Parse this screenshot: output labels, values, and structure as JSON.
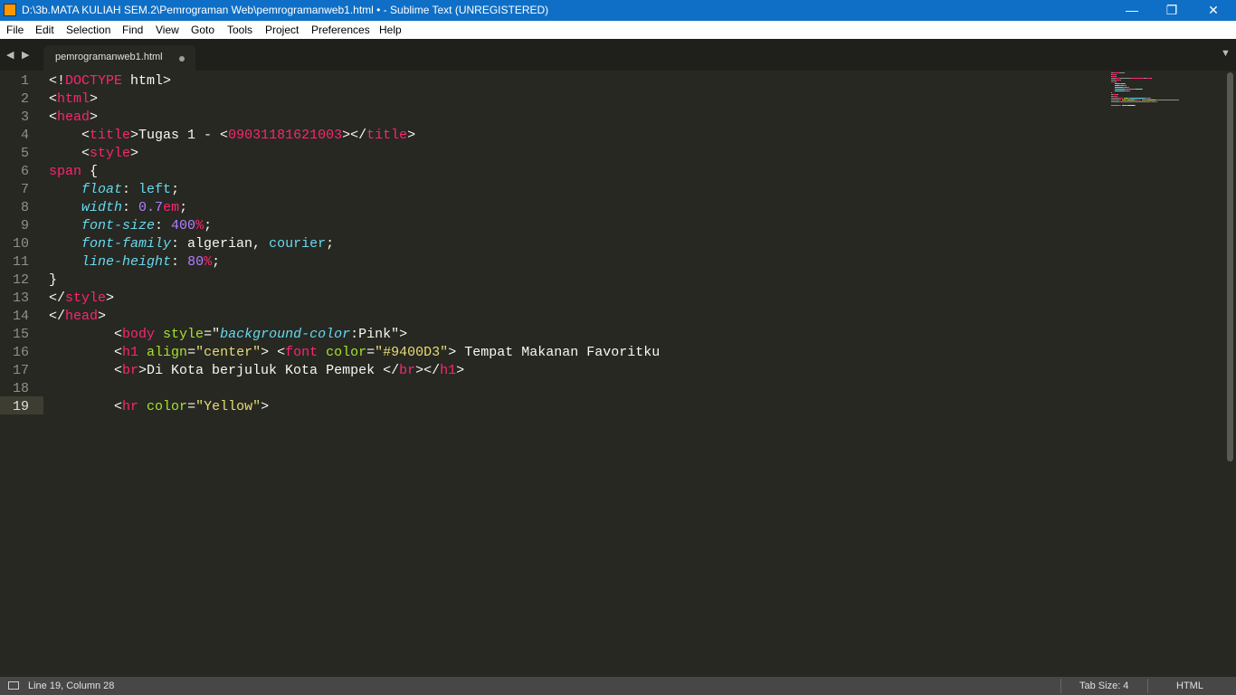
{
  "window": {
    "title": "D:\\3b.MATA KULIAH SEM.2\\Pemrograman Web\\pemrogramanweb1.html • - Sublime Text (UNREGISTERED)",
    "minimize": "—",
    "maximize": "❐",
    "close": "✕"
  },
  "menu": [
    "File",
    "Edit",
    "Selection",
    "Find",
    "View",
    "Goto",
    "Tools",
    "Project",
    "Preferences",
    "Help"
  ],
  "tabs": {
    "back": "◀",
    "forward": "▶",
    "active_tab": "pemrogramanweb1.html",
    "dropdown": "▼"
  },
  "editor": {
    "line_numbers": [
      "1",
      "2",
      "3",
      "4",
      "5",
      "6",
      "7",
      "8",
      "9",
      "10",
      "11",
      "12",
      "13",
      "14",
      "15",
      "16",
      "17",
      "18",
      "19"
    ],
    "active_line": 19,
    "lines": [
      [
        [
          "t",
          "<!"
        ],
        [
          "tag",
          "DOCTYPE"
        ],
        [
          "t",
          " html>"
        ]
      ],
      [
        [
          "t",
          "<"
        ],
        [
          "tag",
          "html"
        ],
        [
          "t",
          ">"
        ]
      ],
      [
        [
          "t",
          "<"
        ],
        [
          "tag",
          "head"
        ],
        [
          "t",
          ">"
        ]
      ],
      [
        [
          "t",
          "    <"
        ],
        [
          "tag",
          "title"
        ],
        [
          "t",
          ">Tugas 1 - <"
        ],
        [
          "tag",
          "09031181621003"
        ],
        [
          "t",
          "></"
        ],
        [
          "tag",
          "title"
        ],
        [
          "t",
          ">"
        ]
      ],
      [
        [
          "t",
          "    <"
        ],
        [
          "tag",
          "style"
        ],
        [
          "t",
          ">"
        ]
      ],
      [
        [
          "sel",
          "span"
        ],
        [
          "t",
          " {"
        ]
      ],
      [
        [
          "t",
          "    "
        ],
        [
          "prop",
          "float"
        ],
        [
          "t",
          ": "
        ],
        [
          "val",
          "left"
        ],
        [
          "t",
          ";"
        ]
      ],
      [
        [
          "t",
          "    "
        ],
        [
          "prop",
          "width"
        ],
        [
          "t",
          ": "
        ],
        [
          "num",
          "0.7"
        ],
        [
          "unit",
          "em"
        ],
        [
          "t",
          ";"
        ]
      ],
      [
        [
          "t",
          "    "
        ],
        [
          "prop",
          "font-size"
        ],
        [
          "t",
          ": "
        ],
        [
          "num",
          "400"
        ],
        [
          "unit",
          "%"
        ],
        [
          "t",
          ";"
        ]
      ],
      [
        [
          "t",
          "    "
        ],
        [
          "prop",
          "font-family"
        ],
        [
          "t",
          ": algerian, "
        ],
        [
          "val",
          "courier"
        ],
        [
          "t",
          ";"
        ]
      ],
      [
        [
          "t",
          "    "
        ],
        [
          "prop",
          "line-height"
        ],
        [
          "t",
          ": "
        ],
        [
          "num",
          "80"
        ],
        [
          "unit",
          "%"
        ],
        [
          "t",
          ";"
        ]
      ],
      [
        [
          "t",
          "}"
        ]
      ],
      [
        [
          "t",
          "</"
        ],
        [
          "tag",
          "style"
        ],
        [
          "t",
          ">"
        ]
      ],
      [
        [
          "t",
          "</"
        ],
        [
          "tag",
          "head"
        ],
        [
          "t",
          ">"
        ]
      ],
      [
        [
          "t",
          "        <"
        ],
        [
          "tag",
          "body"
        ],
        [
          "t",
          " "
        ],
        [
          "attr",
          "style"
        ],
        [
          "t",
          "=\""
        ],
        [
          "prop",
          "background-color"
        ],
        [
          "t",
          ":Pink\">"
        ]
      ],
      [
        [
          "t",
          "        <"
        ],
        [
          "tag",
          "h1"
        ],
        [
          "t",
          " "
        ],
        [
          "attr",
          "align"
        ],
        [
          "t",
          "="
        ],
        [
          "str",
          "\"center\""
        ],
        [
          "t",
          "> <"
        ],
        [
          "tag",
          "font"
        ],
        [
          "t",
          " "
        ],
        [
          "attr",
          "color"
        ],
        [
          "t",
          "="
        ],
        [
          "str",
          "\"#9400D3\""
        ],
        [
          "t",
          "> Tempat Makanan Favoritku"
        ]
      ],
      [
        [
          "t",
          "        <"
        ],
        [
          "tag",
          "br"
        ],
        [
          "t",
          ">Di Kota berjuluk Kota Pempek </"
        ],
        [
          "tag",
          "br"
        ],
        [
          "t",
          "></"
        ],
        [
          "tag",
          "h1"
        ],
        [
          "t",
          ">"
        ]
      ],
      [
        [
          "t",
          ""
        ]
      ],
      [
        [
          "t",
          "        <"
        ],
        [
          "tag",
          "hr"
        ],
        [
          "t",
          " "
        ],
        [
          "attr",
          "color"
        ],
        [
          "t",
          "="
        ],
        [
          "str",
          "\"Yellow\""
        ],
        [
          "t",
          ">"
        ]
      ]
    ]
  },
  "status": {
    "position": "Line 19, Column 28",
    "tab_size": "Tab Size: 4",
    "syntax": "HTML"
  },
  "colors": {
    "background": "#272822",
    "titlebar": "#0F6FC6",
    "tag": "#f92672",
    "attribute": "#a6e22e",
    "string": "#e6db74",
    "property": "#66d9ef",
    "number": "#ae81ff"
  }
}
